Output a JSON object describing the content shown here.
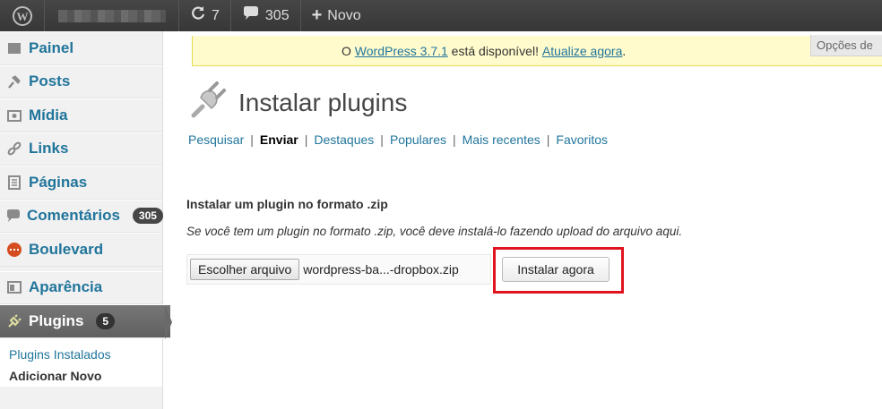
{
  "adminbar": {
    "updates_count": "7",
    "comments_count": "305",
    "new_label": "Novo"
  },
  "sidebar": {
    "items": [
      {
        "label": "Painel",
        "icon": "dashboard-icon"
      },
      {
        "label": "Posts",
        "icon": "pin-icon"
      },
      {
        "label": "Mídia",
        "icon": "media-icon"
      },
      {
        "label": "Links",
        "icon": "link-icon"
      },
      {
        "label": "Páginas",
        "icon": "pages-icon"
      },
      {
        "label": "Comentários",
        "icon": "comment-icon",
        "badge": "305"
      },
      {
        "label": "Boulevard",
        "icon": "boulevard-icon"
      },
      {
        "label": "Aparência",
        "icon": "appearance-icon"
      },
      {
        "label": "Plugins",
        "icon": "plug-icon",
        "badge": "5"
      }
    ],
    "submenu": [
      {
        "label": "Plugins Instalados"
      },
      {
        "label": "Adicionar Novo"
      }
    ]
  },
  "notice": {
    "prefix": "O ",
    "link1": "WordPress 3.7.1",
    "middle": " está disponível! ",
    "link2": "Atualize agora",
    "suffix": "."
  },
  "screen_options": "Opções de",
  "page_title": "Instalar plugins",
  "subsub": {
    "items": [
      "Pesquisar",
      "Enviar",
      "Destaques",
      "Populares",
      "Mais recentes",
      "Favoritos"
    ],
    "separator": "|"
  },
  "upload": {
    "heading": "Instalar um plugin no formato .zip",
    "description": "Se você tem um plugin no formato .zip, você deve instalá-lo fazendo upload do arquivo aqui.",
    "choose_file_label": "Escolher arquivo",
    "file_name": "wordpress-ba...-dropbox.zip",
    "install_label": "Instalar agora"
  },
  "colors": {
    "link": "#21759b",
    "highlight": "#e0141e"
  }
}
